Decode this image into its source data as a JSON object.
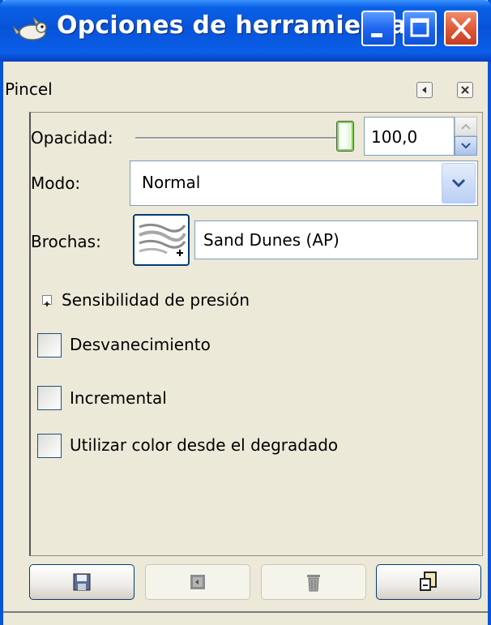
{
  "window": {
    "title": "Opciones de herramienta",
    "icons": {
      "app": "gimp-wilber-icon",
      "minimize": "minimize-icon",
      "maximize": "maximize-icon",
      "close": "close-icon"
    },
    "colors": {
      "titlebar": "#0a5fe6",
      "close_button": "#e05a3a",
      "background": "#ece9d8"
    }
  },
  "dock": {
    "title": "Pincel",
    "menu_icon": "tab-menu-icon",
    "close_icon": "close-tab-icon"
  },
  "options": {
    "opacity": {
      "label": "Opacidad:",
      "value": "100,0",
      "level": 1.0
    },
    "mode": {
      "label": "Modo:",
      "value": "Normal"
    },
    "brushes": {
      "label": "Brochas:",
      "value": "Sand Dunes (AP)",
      "preview_icon": "brush-preview-icon"
    },
    "pressure": {
      "label": "Sensibilidad de presión",
      "expanded": false
    },
    "checkboxes": [
      {
        "label": "Desvanecimiento",
        "checked": false
      },
      {
        "label": "Incremental",
        "checked": false
      },
      {
        "label": "Utilizar color desde el degradado",
        "checked": false
      }
    ]
  },
  "buttons": [
    {
      "icon": "save-icon",
      "enabled": true
    },
    {
      "icon": "restore-icon",
      "enabled": false
    },
    {
      "icon": "delete-icon",
      "enabled": false
    },
    {
      "icon": "reset-icon",
      "enabled": true
    }
  ]
}
